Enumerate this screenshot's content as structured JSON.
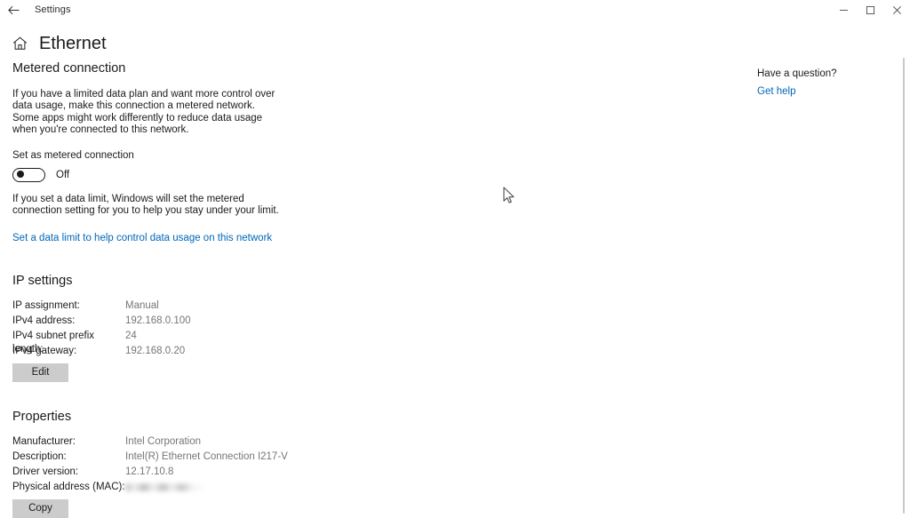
{
  "window": {
    "app_title": "Settings",
    "back_icon": "back-arrow-icon",
    "minimize_label": "Minimize",
    "maximize_label": "Maximize",
    "close_label": "Close"
  },
  "header": {
    "home_icon": "home-icon",
    "title": "Ethernet"
  },
  "metered": {
    "heading": "Metered connection",
    "description": "If you have a limited data plan and want more control over data usage, make this connection a metered network. Some apps might work differently to reduce data usage when you're connected to this network.",
    "toggle_label": "Set as metered connection",
    "toggle_state": "Off",
    "data_limit_text": "If you set a data limit, Windows will set the metered connection setting for you to help you stay under your limit.",
    "data_limit_link": "Set a data limit to help control data usage on this network"
  },
  "ip_settings": {
    "heading": "IP settings",
    "rows": [
      {
        "key": "IP assignment:",
        "value": "Manual"
      },
      {
        "key": "IPv4 address:",
        "value": "192.168.0.100"
      },
      {
        "key": "IPv4 subnet prefix length:",
        "value": "24"
      },
      {
        "key": "IPv4 gateway:",
        "value": "192.168.0.20"
      }
    ],
    "edit_button": "Edit"
  },
  "properties": {
    "heading": "Properties",
    "rows": [
      {
        "key": "Manufacturer:",
        "value": "Intel Corporation"
      },
      {
        "key": "Description:",
        "value": "Intel(R) Ethernet Connection I217-V"
      },
      {
        "key": "Driver version:",
        "value": "12.17.10.8"
      },
      {
        "key": "Physical address (MAC):",
        "value": ""
      }
    ],
    "copy_button": "Copy"
  },
  "help": {
    "question": "Have a question?",
    "link": "Get help"
  },
  "colors": {
    "accent_link": "#0067b8",
    "value_text": "#767676",
    "button_face": "#cccccc",
    "background": "#ffffff"
  }
}
